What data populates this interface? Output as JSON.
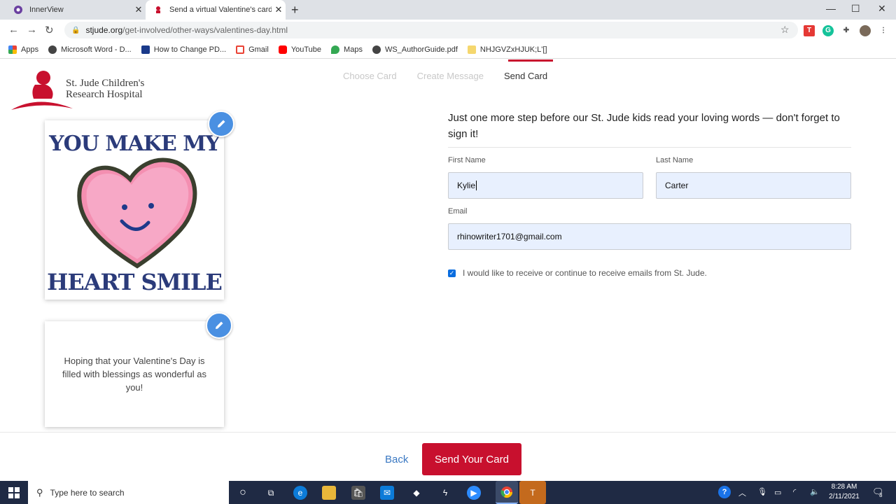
{
  "browser": {
    "tabs": [
      {
        "title": "InnerView",
        "close": "✕"
      },
      {
        "title": "Send a virtual Valentine's card to",
        "close": "✕"
      }
    ],
    "new_tab": "+",
    "url_domain": "stjude.org",
    "url_path": "/get-involved/other-ways/valentines-day.html",
    "bookmarks": [
      {
        "label": "Apps",
        "icon": "apps-grid-icon"
      },
      {
        "label": "Microsoft Word - D...",
        "icon": "globe-icon"
      },
      {
        "label": "How to Change PD...",
        "icon": "flag-icon"
      },
      {
        "label": "Gmail",
        "icon": "gmail-icon"
      },
      {
        "label": "YouTube",
        "icon": "youtube-icon"
      },
      {
        "label": "Maps",
        "icon": "maps-pin-icon"
      },
      {
        "label": "WS_AuthorGuide.pdf",
        "icon": "globe-icon"
      },
      {
        "label": "NHJGVZxHJUK;L'[]",
        "icon": "folder-icon"
      }
    ]
  },
  "page": {
    "logo": {
      "line1": "St. Jude Children's",
      "line2": "Research Hospital"
    },
    "steps": [
      {
        "label": "Choose Card",
        "active": false
      },
      {
        "label": "Create Message",
        "active": false
      },
      {
        "label": "Send Card",
        "active": true
      }
    ],
    "card": {
      "line1": "YOU MAKE MY",
      "line2": "HEART SMILE"
    },
    "message": "Hoping that your Valentine's Day is filled with blessings as wonderful as you!",
    "lead": "Just one more step before our St. Jude kids read your loving words — don't forget to sign it!",
    "form": {
      "first_name_label": "First Name",
      "first_name_value": "Kylie",
      "last_name_label": "Last Name",
      "last_name_value": "Carter",
      "email_label": "Email",
      "email_value": "rhinowriter1701@gmail.com",
      "optin_checked": true,
      "optin_label": "I would like to receive or continue to receive emails from St. Jude."
    },
    "back_label": "Back",
    "send_label": "Send Your Card"
  },
  "taskbar": {
    "search_placeholder": "Type here to search",
    "time": "8:28 AM",
    "date": "2/11/2021",
    "notification_count": "3"
  },
  "colors": {
    "brand_red": "#c8102e",
    "link_blue": "#3a78c2",
    "edit_blue": "#4a90e2"
  }
}
